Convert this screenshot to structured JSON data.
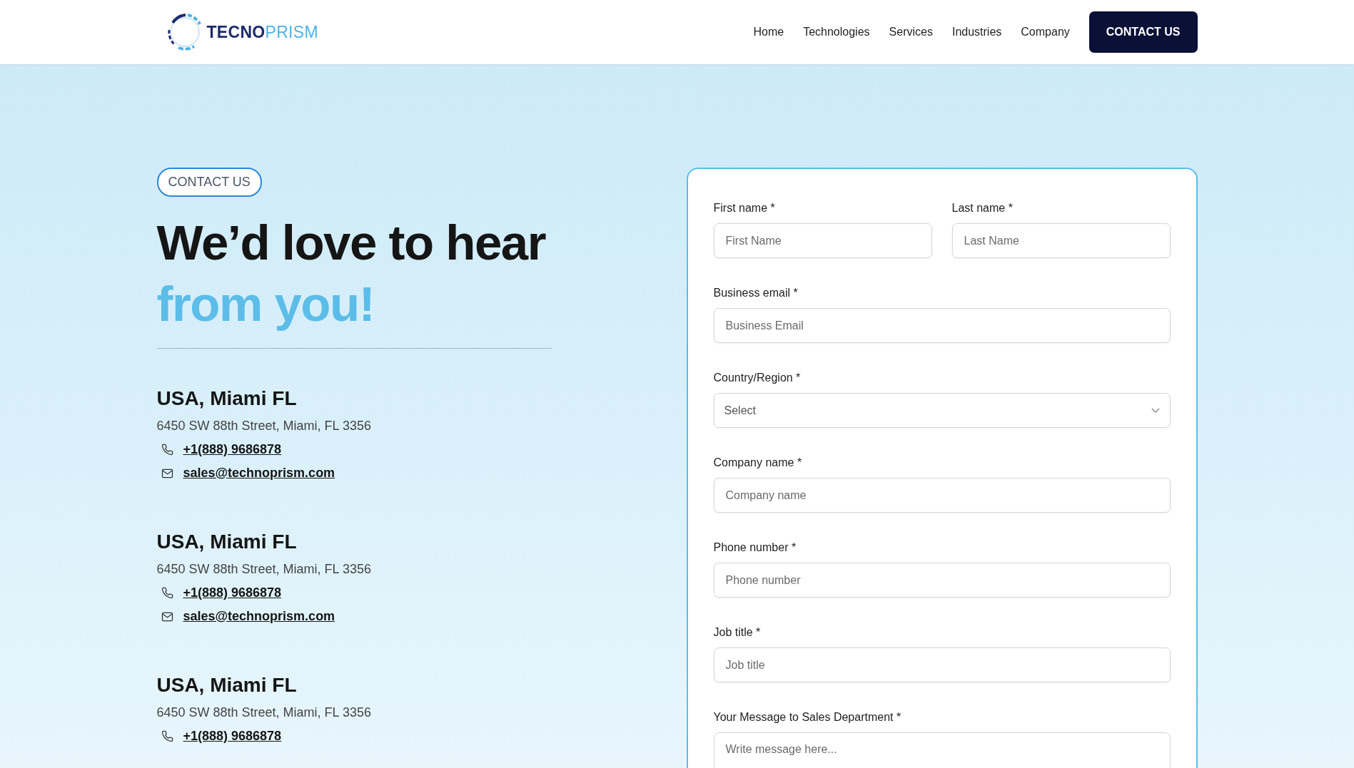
{
  "logo": {
    "primary": "TECNO",
    "secondary": "PRISM"
  },
  "nav": {
    "links": [
      "Home",
      "Technologies",
      "Services",
      "Industries",
      "Company"
    ],
    "cta": "CONTACT US"
  },
  "hero": {
    "badge": "CONTACT US",
    "headline_line_1": "We’d love to hear",
    "headline_line_2": "from you!"
  },
  "offices": [
    {
      "title": "USA, Miami FL",
      "address": "6450 SW 88th Street, Miami, FL 3356",
      "phone": "+1(888) 9686878",
      "email": "sales@technoprism.com"
    },
    {
      "title": "USA, Miami FL",
      "address": "6450 SW 88th Street, Miami, FL 3356",
      "phone": "+1(888) 9686878",
      "email": "sales@technoprism.com"
    },
    {
      "title": "USA, Miami FL",
      "address": "6450 SW 88th Street, Miami, FL 3356",
      "phone": "+1(888) 9686878"
    }
  ],
  "form": {
    "rows": [
      [
        {
          "kind": "text",
          "label": "First name *",
          "placeholder": "First Name"
        },
        {
          "kind": "text",
          "label": "Last name *",
          "placeholder": "Last Name"
        }
      ],
      [
        {
          "kind": "text",
          "label": "Business email *",
          "placeholder": "Business Email"
        }
      ],
      [
        {
          "kind": "select",
          "label": "Country/Region *",
          "placeholder": "Select"
        }
      ],
      [
        {
          "kind": "text",
          "label": "Company name *",
          "placeholder": "Company name"
        }
      ],
      [
        {
          "kind": "text",
          "label": "Phone number *",
          "placeholder": "Phone number"
        }
      ],
      [
        {
          "kind": "text",
          "label": "Job title *",
          "placeholder": "Job title"
        }
      ],
      [
        {
          "kind": "textarea",
          "label": "Your Message to Sales Department *",
          "placeholder": "Write message here..."
        }
      ]
    ]
  }
}
